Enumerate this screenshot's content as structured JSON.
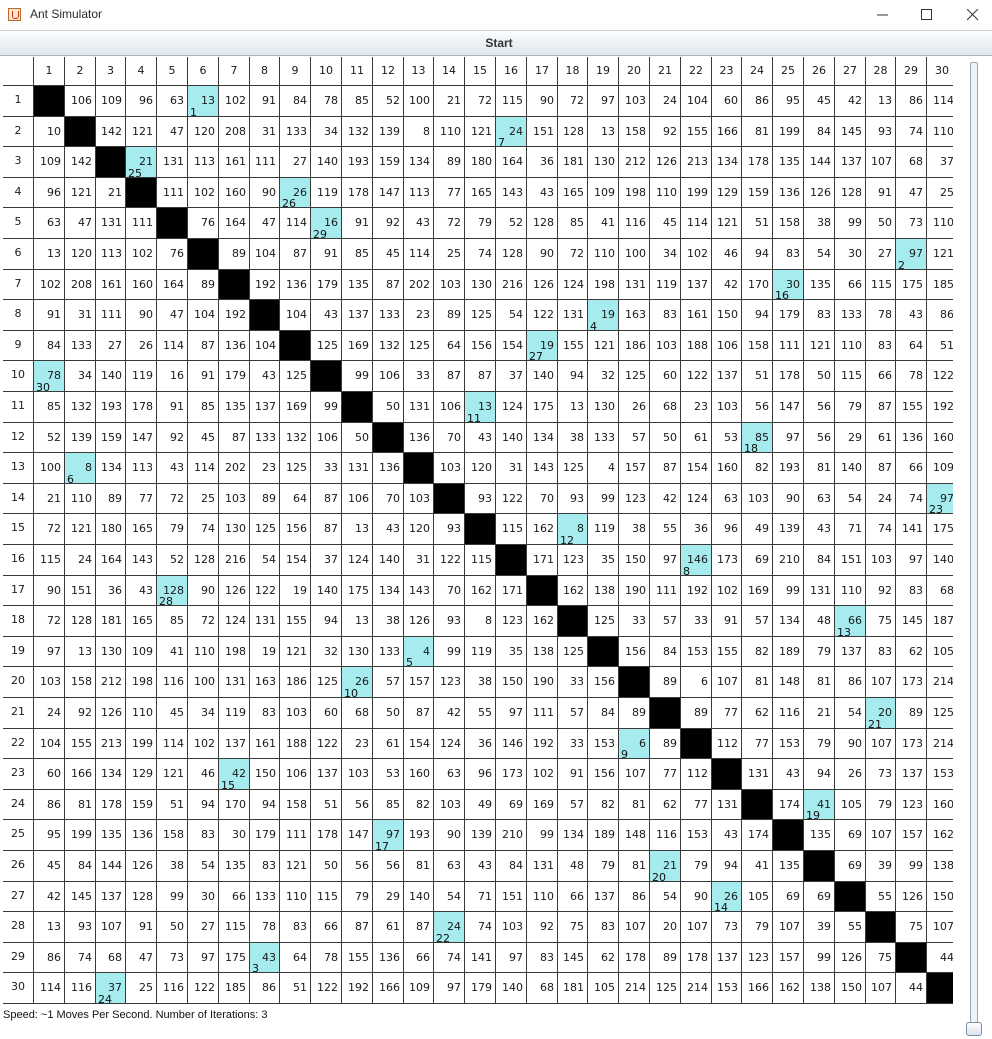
{
  "window": {
    "title": "Ant Simulator",
    "icon": "java-cup-icon"
  },
  "toolbar": {
    "start_label": "Start"
  },
  "status": {
    "text": "Speed: ~1 Moves Per Second. Number of Iterations: 3"
  },
  "colors": {
    "diagonal": "#000000",
    "ant_cell": "#a6ecef",
    "grid_line": "#3a3a3a"
  },
  "column_headers": [
    "1",
    "2",
    "3",
    "4",
    "5",
    "6",
    "7",
    "8",
    "9",
    "10",
    "11",
    "12",
    "13",
    "14",
    "15",
    "16",
    "17",
    "18",
    "19",
    "20",
    "21",
    "22",
    "23",
    "24",
    "25",
    "26",
    "27",
    "28",
    "29",
    "30"
  ],
  "row_headers": [
    "1",
    "2",
    "3",
    "4",
    "5",
    "6",
    "7",
    "8",
    "9",
    "10",
    "11",
    "12",
    "13",
    "14",
    "15",
    "16",
    "17",
    "18",
    "19",
    "20",
    "21",
    "22",
    "23",
    "24",
    "25",
    "26",
    "27",
    "28",
    "29",
    "30"
  ],
  "matrix": [
    [
      "",
      106,
      109,
      96,
      63,
      13,
      102,
      91,
      84,
      78,
      85,
      52,
      100,
      21,
      72,
      115,
      90,
      72,
      97,
      103,
      24,
      104,
      60,
      86,
      95,
      45,
      42,
      13,
      86,
      114
    ],
    [
      10,
      "",
      142,
      121,
      47,
      120,
      208,
      31,
      133,
      34,
      132,
      139,
      8,
      110,
      121,
      24,
      151,
      128,
      13,
      158,
      92,
      155,
      166,
      81,
      199,
      84,
      145,
      93,
      74,
      110
    ],
    [
      109,
      142,
      "",
      21,
      131,
      113,
      161,
      111,
      27,
      140,
      193,
      159,
      134,
      89,
      180,
      164,
      36,
      181,
      130,
      212,
      126,
      213,
      134,
      178,
      135,
      144,
      137,
      107,
      68,
      37
    ],
    [
      96,
      121,
      21,
      "",
      111,
      102,
      160,
      90,
      26,
      119,
      178,
      147,
      113,
      77,
      165,
      143,
      43,
      165,
      109,
      198,
      110,
      199,
      129,
      159,
      136,
      126,
      128,
      91,
      47,
      25
    ],
    [
      63,
      47,
      131,
      111,
      "",
      76,
      164,
      47,
      114,
      16,
      91,
      92,
      43,
      72,
      79,
      52,
      128,
      85,
      41,
      116,
      45,
      114,
      121,
      51,
      158,
      38,
      99,
      50,
      73,
      110
    ],
    [
      13,
      120,
      113,
      102,
      76,
      "",
      89,
      104,
      87,
      91,
      85,
      45,
      114,
      25,
      74,
      128,
      90,
      72,
      110,
      100,
      34,
      102,
      46,
      94,
      83,
      54,
      30,
      27,
      97,
      121
    ],
    [
      102,
      208,
      161,
      160,
      164,
      89,
      "",
      192,
      136,
      179,
      135,
      87,
      202,
      103,
      130,
      216,
      126,
      124,
      198,
      131,
      119,
      137,
      42,
      170,
      30,
      135,
      66,
      115,
      175,
      185
    ],
    [
      91,
      31,
      111,
      90,
      47,
      104,
      192,
      "",
      104,
      43,
      137,
      133,
      23,
      89,
      125,
      54,
      122,
      131,
      19,
      163,
      83,
      161,
      150,
      94,
      179,
      83,
      133,
      78,
      43,
      86
    ],
    [
      84,
      133,
      27,
      26,
      114,
      87,
      136,
      104,
      "",
      125,
      169,
      132,
      125,
      64,
      156,
      154,
      19,
      155,
      121,
      186,
      103,
      188,
      106,
      158,
      111,
      121,
      110,
      83,
      64,
      51
    ],
    [
      78,
      34,
      140,
      119,
      16,
      91,
      179,
      43,
      125,
      "",
      99,
      106,
      33,
      87,
      87,
      37,
      140,
      94,
      32,
      125,
      60,
      122,
      137,
      51,
      178,
      50,
      115,
      66,
      78,
      122
    ],
    [
      85,
      132,
      193,
      178,
      91,
      85,
      135,
      137,
      169,
      99,
      "",
      50,
      131,
      106,
      13,
      124,
      175,
      13,
      130,
      26,
      68,
      23,
      103,
      56,
      147,
      56,
      79,
      87,
      155,
      192
    ],
    [
      52,
      139,
      159,
      147,
      92,
      45,
      87,
      133,
      132,
      106,
      50,
      "",
      136,
      70,
      43,
      140,
      134,
      38,
      133,
      57,
      50,
      61,
      53,
      85,
      97,
      56,
      29,
      61,
      136,
      160
    ],
    [
      100,
      8,
      134,
      113,
      43,
      114,
      202,
      23,
      125,
      33,
      131,
      136,
      "",
      103,
      120,
      31,
      143,
      125,
      4,
      157,
      87,
      154,
      160,
      82,
      193,
      81,
      140,
      87,
      66,
      109
    ],
    [
      21,
      110,
      89,
      77,
      72,
      25,
      103,
      89,
      64,
      87,
      106,
      70,
      103,
      "",
      93,
      122,
      70,
      93,
      99,
      123,
      42,
      124,
      63,
      103,
      90,
      63,
      54,
      24,
      74,
      97
    ],
    [
      72,
      121,
      180,
      165,
      79,
      74,
      130,
      125,
      156,
      87,
      13,
      43,
      120,
      93,
      "",
      115,
      162,
      8,
      119,
      38,
      55,
      36,
      96,
      49,
      139,
      43,
      71,
      74,
      141,
      175
    ],
    [
      115,
      24,
      164,
      143,
      52,
      128,
      216,
      54,
      154,
      37,
      124,
      140,
      31,
      122,
      115,
      "",
      171,
      123,
      35,
      150,
      97,
      146,
      173,
      69,
      210,
      84,
      151,
      103,
      97,
      140
    ],
    [
      90,
      151,
      36,
      43,
      128,
      90,
      126,
      122,
      19,
      140,
      175,
      134,
      143,
      70,
      162,
      171,
      "",
      162,
      138,
      190,
      111,
      192,
      102,
      169,
      99,
      131,
      110,
      92,
      83,
      68
    ],
    [
      72,
      128,
      181,
      165,
      85,
      72,
      124,
      131,
      155,
      94,
      13,
      38,
      126,
      93,
      8,
      123,
      162,
      "",
      125,
      33,
      57,
      33,
      91,
      57,
      134,
      48,
      66,
      75,
      145,
      187
    ],
    [
      97,
      13,
      130,
      109,
      41,
      110,
      198,
      19,
      121,
      32,
      130,
      133,
      4,
      99,
      119,
      35,
      138,
      125,
      "",
      156,
      84,
      153,
      155,
      82,
      189,
      79,
      137,
      83,
      62,
      105
    ],
    [
      103,
      158,
      212,
      198,
      116,
      100,
      131,
      163,
      186,
      125,
      26,
      57,
      157,
      123,
      38,
      150,
      190,
      33,
      156,
      "",
      89,
      6,
      107,
      81,
      148,
      81,
      86,
      107,
      173,
      214
    ],
    [
      24,
      92,
      126,
      110,
      45,
      34,
      119,
      83,
      103,
      60,
      68,
      50,
      87,
      42,
      55,
      97,
      111,
      57,
      84,
      89,
      "",
      89,
      77,
      62,
      116,
      21,
      54,
      20,
      89,
      125
    ],
    [
      104,
      155,
      213,
      199,
      114,
      102,
      137,
      161,
      188,
      122,
      23,
      61,
      154,
      124,
      36,
      146,
      192,
      33,
      153,
      6,
      89,
      "",
      112,
      77,
      153,
      79,
      90,
      107,
      173,
      214
    ],
    [
      60,
      166,
      134,
      129,
      121,
      46,
      42,
      150,
      106,
      137,
      103,
      53,
      160,
      63,
      96,
      173,
      102,
      91,
      156,
      107,
      77,
      112,
      "",
      131,
      43,
      94,
      26,
      73,
      137,
      153
    ],
    [
      86,
      81,
      178,
      159,
      51,
      94,
      170,
      94,
      158,
      51,
      56,
      85,
      82,
      103,
      49,
      69,
      169,
      57,
      82,
      81,
      62,
      77,
      131,
      "",
      174,
      41,
      105,
      79,
      123,
      160
    ],
    [
      95,
      199,
      135,
      136,
      158,
      83,
      30,
      179,
      111,
      178,
      147,
      97,
      193,
      90,
      139,
      210,
      99,
      134,
      189,
      148,
      116,
      153,
      43,
      174,
      "",
      135,
      69,
      107,
      157,
      162
    ],
    [
      45,
      84,
      144,
      126,
      38,
      54,
      135,
      83,
      121,
      50,
      56,
      56,
      81,
      63,
      43,
      84,
      131,
      48,
      79,
      81,
      21,
      79,
      94,
      41,
      135,
      "",
      69,
      39,
      99,
      138
    ],
    [
      42,
      145,
      137,
      128,
      99,
      30,
      66,
      133,
      110,
      115,
      79,
      29,
      140,
      54,
      71,
      151,
      110,
      66,
      137,
      86,
      54,
      90,
      26,
      105,
      69,
      69,
      "",
      55,
      126,
      150
    ],
    [
      13,
      93,
      107,
      91,
      50,
      27,
      115,
      78,
      83,
      66,
      87,
      61,
      87,
      24,
      74,
      103,
      92,
      75,
      83,
      107,
      20,
      107,
      73,
      79,
      107,
      39,
      55,
      "",
      75,
      107
    ],
    [
      86,
      74,
      68,
      47,
      73,
      97,
      175,
      43,
      64,
      78,
      155,
      136,
      66,
      74,
      141,
      97,
      83,
      145,
      62,
      178,
      89,
      178,
      137,
      123,
      157,
      99,
      126,
      75,
      "",
      44
    ],
    [
      114,
      116,
      37,
      25,
      116,
      122,
      185,
      86,
      51,
      122,
      192,
      166,
      109,
      97,
      179,
      140,
      68,
      181,
      105,
      214,
      125,
      214,
      153,
      166,
      162,
      138,
      150,
      107,
      44,
      ""
    ]
  ],
  "ants": [
    {
      "row": 1,
      "col": 6,
      "ant": "1"
    },
    {
      "row": 2,
      "col": 16,
      "ant": "7"
    },
    {
      "row": 3,
      "col": 4,
      "ant": "25"
    },
    {
      "row": 4,
      "col": 9,
      "ant": "26"
    },
    {
      "row": 5,
      "col": 10,
      "ant": "29"
    },
    {
      "row": 6,
      "col": 29,
      "ant": "2"
    },
    {
      "row": 7,
      "col": 25,
      "ant": "16"
    },
    {
      "row": 8,
      "col": 19,
      "ant": "4"
    },
    {
      "row": 9,
      "col": 17,
      "ant": "27"
    },
    {
      "row": 10,
      "col": 1,
      "ant": "30"
    },
    {
      "row": 11,
      "col": 15,
      "ant": "11"
    },
    {
      "row": 12,
      "col": 24,
      "ant": "18"
    },
    {
      "row": 13,
      "col": 2,
      "ant": "6"
    },
    {
      "row": 14,
      "col": 30,
      "ant": "23"
    },
    {
      "row": 15,
      "col": 18,
      "ant": "12"
    },
    {
      "row": 16,
      "col": 22,
      "ant": "8"
    },
    {
      "row": 17,
      "col": 5,
      "ant": "28"
    },
    {
      "row": 18,
      "col": 27,
      "ant": "13"
    },
    {
      "row": 19,
      "col": 13,
      "ant": "5"
    },
    {
      "row": 20,
      "col": 11,
      "ant": "10"
    },
    {
      "row": 21,
      "col": 28,
      "ant": "21"
    },
    {
      "row": 22,
      "col": 20,
      "ant": "9"
    },
    {
      "row": 23,
      "col": 7,
      "ant": "15"
    },
    {
      "row": 24,
      "col": 26,
      "ant": "19"
    },
    {
      "row": 25,
      "col": 12,
      "ant": "17"
    },
    {
      "row": 26,
      "col": 21,
      "ant": "20"
    },
    {
      "row": 27,
      "col": 23,
      "ant": "14"
    },
    {
      "row": 28,
      "col": 14,
      "ant": "22"
    },
    {
      "row": 29,
      "col": 8,
      "ant": "3"
    },
    {
      "row": 30,
      "col": 3,
      "ant": "24"
    }
  ]
}
